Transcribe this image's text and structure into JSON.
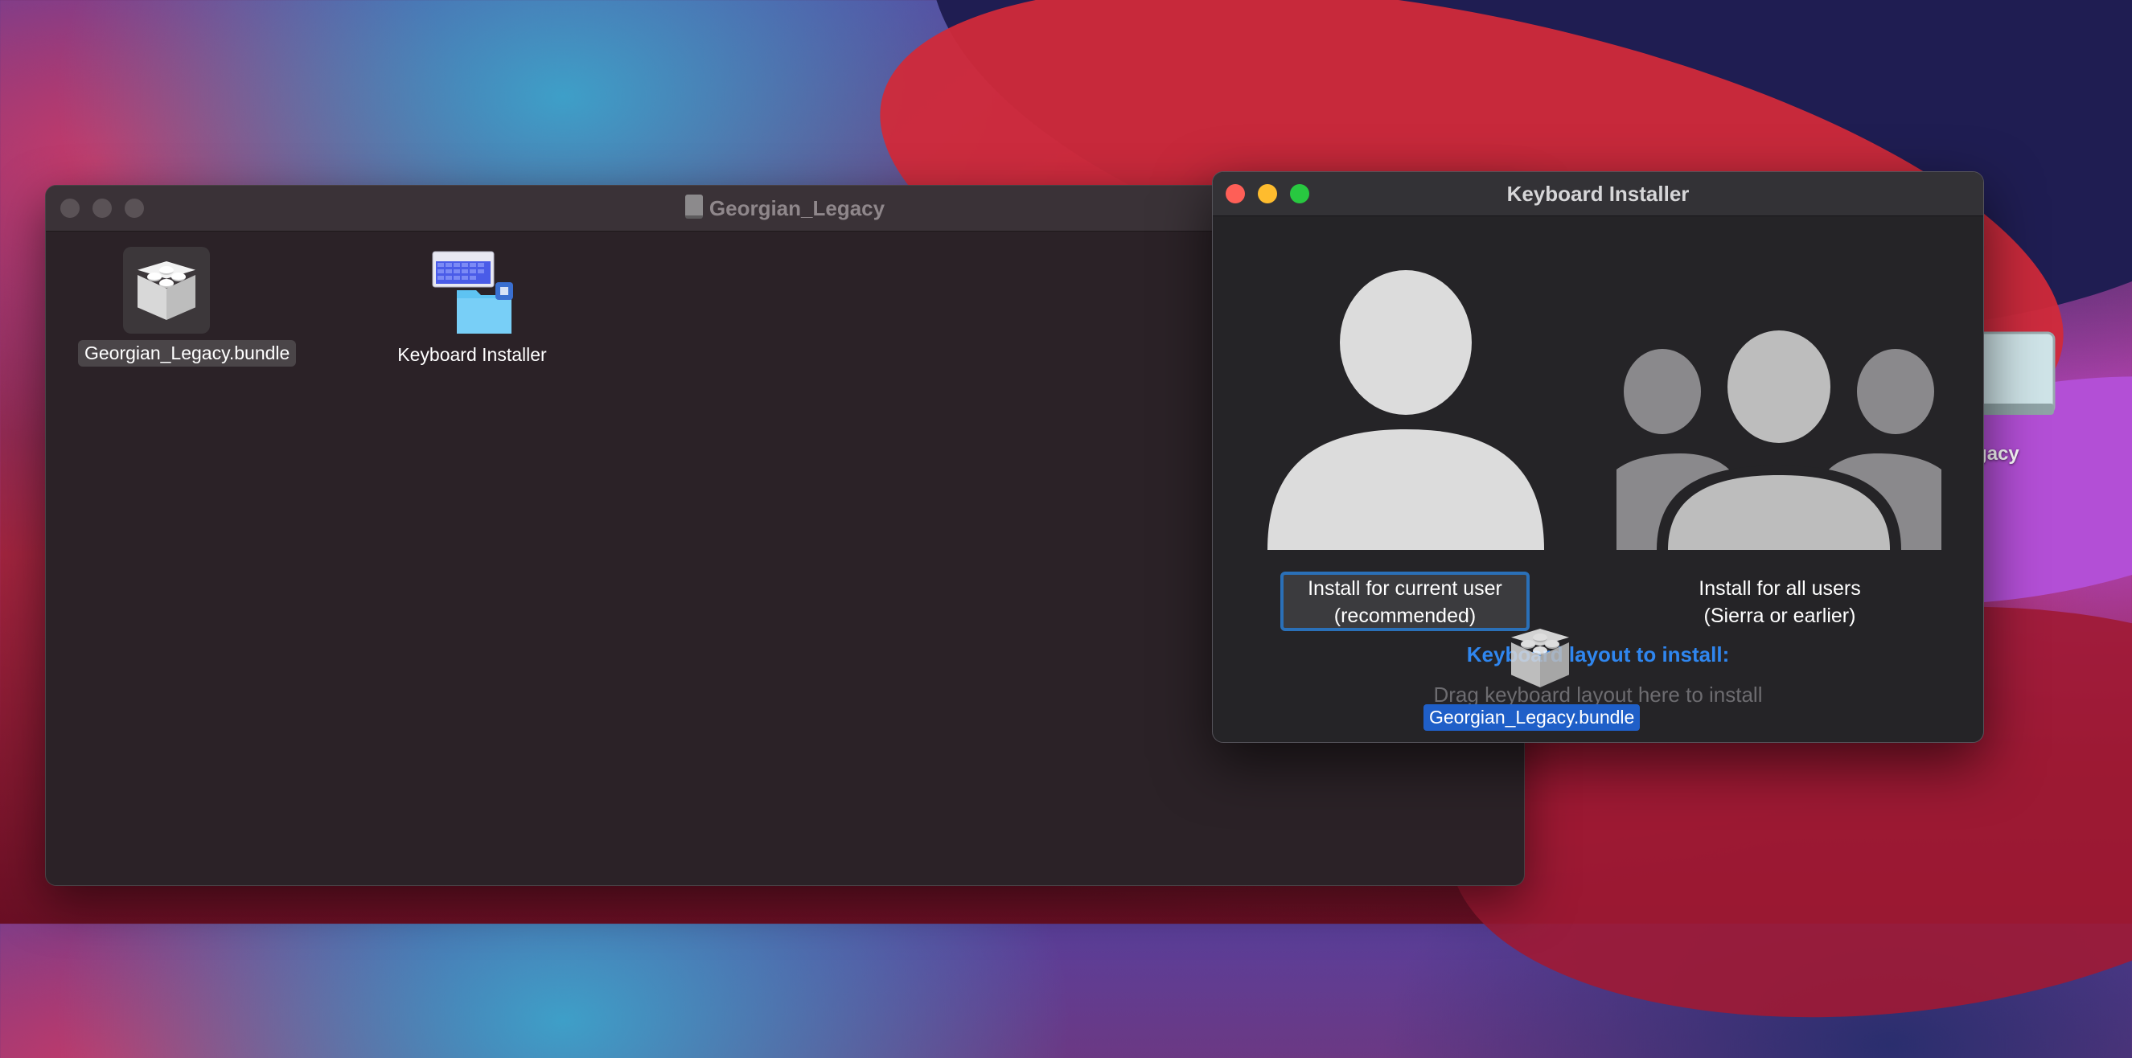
{
  "colors": {
    "accent": "#2f86ef",
    "selection": "#1f5fc8",
    "close": "#fe5f57",
    "minimize": "#febc2e",
    "zoom": "#28c840"
  },
  "finder_window": {
    "title": "Georgian_Legacy",
    "title_icon": "disk-icon",
    "items": [
      {
        "label": "Georgian_Legacy.bundle",
        "icon": "bundle-icon",
        "selected": true
      },
      {
        "label": "Keyboard Installer",
        "icon": "keyboard-installer-app-icon",
        "selected": false
      }
    ]
  },
  "installer_window": {
    "title": "Keyboard Installer",
    "current_user_option": {
      "line1": "Install for current user",
      "line2": "(recommended)",
      "icon": "single-user-icon"
    },
    "all_users_option": {
      "line1": "Install for all users",
      "line2": "(Sierra or earlier)",
      "icon": "group-users-icon"
    },
    "section_title": "Keyboard layout to install:",
    "drop_hint": "Drag keyboard layout here to install"
  },
  "drag_item": {
    "label": "Georgian_Legacy.bundle",
    "icon": "bundle-icon"
  },
  "desktop": {
    "disk_label": "ian_Legacy",
    "disk_icon": "external-disk-icon"
  }
}
